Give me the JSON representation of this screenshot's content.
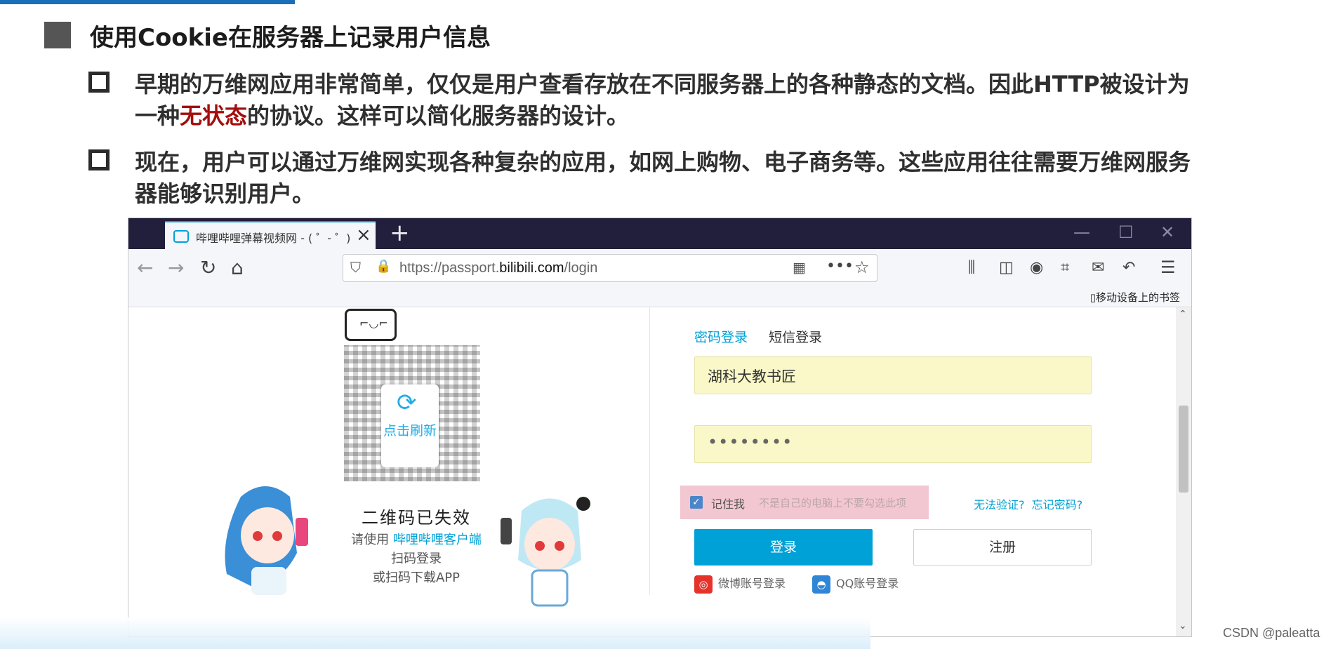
{
  "slide": {
    "heading": "使用Cookie在服务器上记录用户信息",
    "point1_line1": "早期的万维网应用非常简单，仅仅是用户查看存放在不同服务器上的各种静态的文档。因此HTTP被设计为",
    "point1_line2_pre": "一种",
    "point1_line2_red": "无状态",
    "point1_line2_post": "的协议。这样可以简化服务器的设计。",
    "point2_line1": "现在，用户可以通过万维网实现各种复杂的应用，如网上购物、电子商务等。这些应用往往需要万维网服务",
    "point2_line2": "器能够识别用户。"
  },
  "browser": {
    "tab_title": "哔哩哔哩弹幕视频网 - ( ゜- ゜)",
    "new_tab": "+",
    "url_prefix": "https://passport.",
    "url_domain": "bilibili.com",
    "url_path": "/login",
    "mobile_bookmarks": "移动设备上的书签"
  },
  "qr_panel": {
    "refresh_label": "点击刷新",
    "expired": "二维码已失效",
    "help_pre": "请使用",
    "help_link": "哔哩哔哩客户端",
    "help_line2": "扫码登录",
    "help_line3": "或扫码下载APP"
  },
  "login": {
    "tab_password": "密码登录",
    "tab_sms": "短信登录",
    "username_value": "湖科大教书匠",
    "password_value": "••••••••",
    "remember_label": "记住我",
    "remember_hint": "不是自己的电脑上不要勾选此项",
    "cannot_verify": "无法验证?",
    "forgot_password": "忘记密码?",
    "login_button": "登录",
    "register_button": "注册",
    "weibo_login": "微博账号登录",
    "qq_login": "QQ账号登录"
  },
  "watermark": "CSDN @paleatta",
  "colors": {
    "accent": "#00a1d6",
    "highlight": "#a40e0e",
    "tabbar": "#221f3d"
  }
}
